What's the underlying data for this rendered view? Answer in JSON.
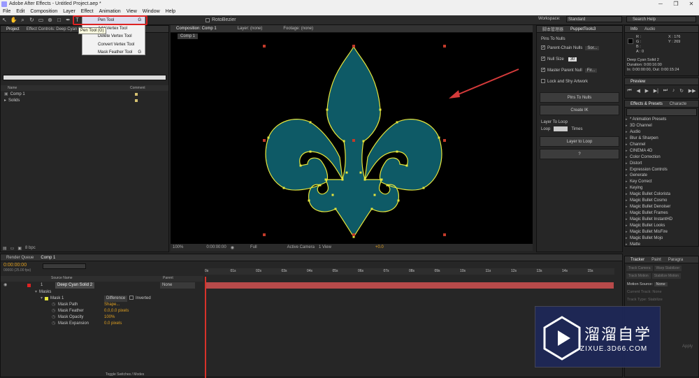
{
  "window": {
    "title": "Adobe After Effects - Untitled Project.aep *",
    "controls": [
      "─",
      "❐",
      "✕"
    ]
  },
  "menu": [
    "File",
    "Edit",
    "Composition",
    "Layer",
    "Effect",
    "Animation",
    "View",
    "Window",
    "Help"
  ],
  "toolbar": {
    "pen_menu": [
      "Pen Tool",
      "Add Vertex Tool",
      "Delete Vertex Tool",
      "Convert Vertex Tool",
      "Mask Feather Tool"
    ],
    "pen_menu_keys": [
      "G",
      "",
      "",
      "",
      "G"
    ],
    "tooltip": "Pen Tool (G)",
    "rotobezier": "RotoBezier",
    "workspace_label": "Workspace:",
    "workspace_value": "Standard",
    "search_placeholder": "Search Help"
  },
  "project": {
    "tab_project": "Project",
    "tab_effect_controls": "Effect Controls: Deep Cyan Solid 2",
    "search_placeholder": "",
    "col_name": "Name",
    "col_comment": "Comment",
    "items": [
      "Comp 1",
      "Solids"
    ],
    "bpc": "8 bpc"
  },
  "viewer": {
    "tab_comp": "Composition: Comp 1",
    "tab_layer": "Layer: (none)",
    "tab_footage": "Footage: (none)",
    "breadcrumb": "Comp 1",
    "zoom": "100%",
    "time": "0:00:00:00",
    "resolution": "Full",
    "camera": "Active Camera",
    "view": "1 View",
    "exposure": "+0.0"
  },
  "script_panel": {
    "tab1": "脚本管理器",
    "tab2": "PuppetTools3",
    "section1": "Pins To Nulls",
    "parent_chain": "Parent-Chain Nulls",
    "sort_value": "Sor...",
    "null_size_label": "Null Size",
    "null_size_value": "30",
    "master_parent": "Master Parent Null",
    "master_value": "Fir...",
    "lock_shy": "Lock and Shy Artwork",
    "pins_to_nulls_btn": "Pins To Nulls",
    "create_ik_btn": "Create IK",
    "section2": "Layer To Loop",
    "loop_label": "Loop",
    "times_label": "Times",
    "layer_to_loop_btn": "Layer to Loop",
    "help_btn": "?"
  },
  "info": {
    "tab_info": "Info",
    "tab_audio": "Audio",
    "r": "R :",
    "g": "G :",
    "b": "B :",
    "a": "A : 0",
    "x": "X : 176",
    "y": "Y : 269",
    "layer_name": "Deep Cyan Solid 2",
    "duration": "Duration: 0:00:16:00",
    "in_out": "In: 0:00:00:00, Out: 0:00:15:24"
  },
  "preview": {
    "tab": "Preview"
  },
  "effects": {
    "tab": "Effects & Presets",
    "tab2": "Characte",
    "items": [
      "* Animation Presets",
      "3D Channel",
      "Audio",
      "Blur & Sharpen",
      "Channel",
      "CINEMA 4D",
      "Color Correction",
      "Distort",
      "Expression Controls",
      "Generate",
      "Key Correct",
      "Keying",
      "Magic Bullet Colorista",
      "Magic Bullet Cosmo",
      "Magic Bullet Denoiser",
      "Magic Bullet Frames",
      "Magic Bullet InstantHD",
      "Magic Bullet Looks",
      "Magic Bullet MisFire",
      "Magic Bullet Mojo",
      "Matte"
    ]
  },
  "tracker": {
    "tab1": "Tracker",
    "tab2": "Paint",
    "tab3": "Paragra",
    "track_camera": "Track Camera",
    "warp_stabilizer": "Warp Stabilizer",
    "track_motion": "Track Motion",
    "stabilize_motion": "Stabilize Motion",
    "motion_source_label": "Motion Source:",
    "motion_source_value": "None",
    "current_track": "Current Track:",
    "current_track_value": "None",
    "track_type": "Track Type:",
    "track_type_value": "Stabilize",
    "apply": "Apply"
  },
  "timeline": {
    "tab_render": "Render Queue",
    "tab_comp": "Comp 1",
    "time": "0:00:00:00",
    "fps": "00000 (25.00 fps)",
    "col_source": "Source Name",
    "col_parent": "Parent",
    "layer_num": "1",
    "layer_name": "Deep Cyan Solid 2",
    "parent_value": "None",
    "masks_label": "Masks",
    "mask1": "Mask 1",
    "mask_mode": "Difference",
    "inverted": "Inverted",
    "props": [
      {
        "name": "Mask Path",
        "value": "Shape..."
      },
      {
        "name": "Mask Feather",
        "value": "0.0,0.0 pixels"
      },
      {
        "name": "Mask Opacity",
        "value": "100%"
      },
      {
        "name": "Mask Expansion",
        "value": "0.0 pixels"
      }
    ],
    "ruler": [
      "0s",
      "01s",
      "02s",
      "03s",
      "04s",
      "05s",
      "06s",
      "07s",
      "08s",
      "09s",
      "10s",
      "11s",
      "12s",
      "13s",
      "14s",
      "15s"
    ],
    "toggle": "Toggle Switches / Modes"
  },
  "watermark": {
    "title": "溜溜自学",
    "url": "ZIXUE.3D66.COM"
  },
  "colors": {
    "shape_fill": "#0e5a66",
    "shape_stroke": "#e6e63c",
    "arrow": "#d43a3a",
    "timeline_bar": "#b84a4a"
  }
}
